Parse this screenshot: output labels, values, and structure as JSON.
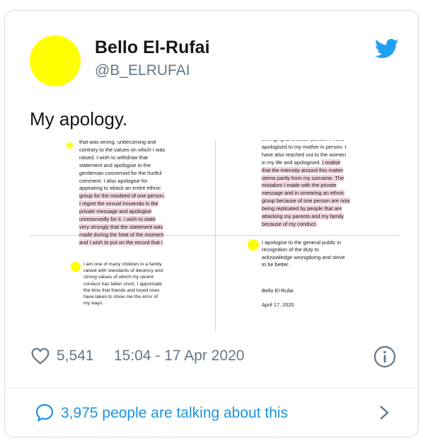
{
  "tweet": {
    "author_name": "Bello El-Rufai",
    "handle": "@B_ELRUFAI",
    "text": "My apology.",
    "avatar_color": "#ffff00",
    "brand_icon": "twitter-bird-icon",
    "brand_color": "#1da1f2"
  },
  "media": {
    "pane1": {
      "plain": "that was wrong, unbecoming and\ncontrary to the values on which I was\nraised. I wish to withdraw that\nstatement and apologise to the\ngentleman concerned for the hurtful\ncomment. I also apologise for\nappearing to attack an entire ethnic\n",
      "highlighted": "group for the misdeed of one person.\nI regret the sexual innuendo in the\nprivate message and apologise\nunreservedly for it. I wish to state\nvery strongly that the statement was\nmade during the heat of the moment\nand I wish to put on the record that I"
    },
    "pane2": {
      "plain": "emerging as a better person. I have\napologised to my mother in person. I\nhave also reached out to the women\nin my life and apologised. ",
      "highlighted": "I realise\nthat the intensity around this matter\nstems partly from my surname. The\nmistakes I made with the private\nmessage and in smearing an ethnic\ngroup because of one person are now\nbeing replicated by people that are\nattacking my parents and my family\nbecause of my conduct."
    },
    "pane3": "I am one of many children in a family\nraised with standards of decency and\nstrong values of which my recent\nconduct has fallen short. I appreciate\nthe time that friends and loved ones\nhave taken to show me the error of\nmy ways.",
    "pane4": "I apologise to the general public in\nrecognition of the duty to\nacknowledge wrongdoing and strive\nto be better.",
    "signature_name": "Bello El-Rufai",
    "signature_date": "April 17, 2020",
    "highlight_color": "#f2d6e0"
  },
  "footer": {
    "likes": "5,541",
    "timestamp": "15:04 - 17 Apr 2020",
    "talking": "3,975 people are talking about this",
    "accent_color": "#1b95e0"
  }
}
